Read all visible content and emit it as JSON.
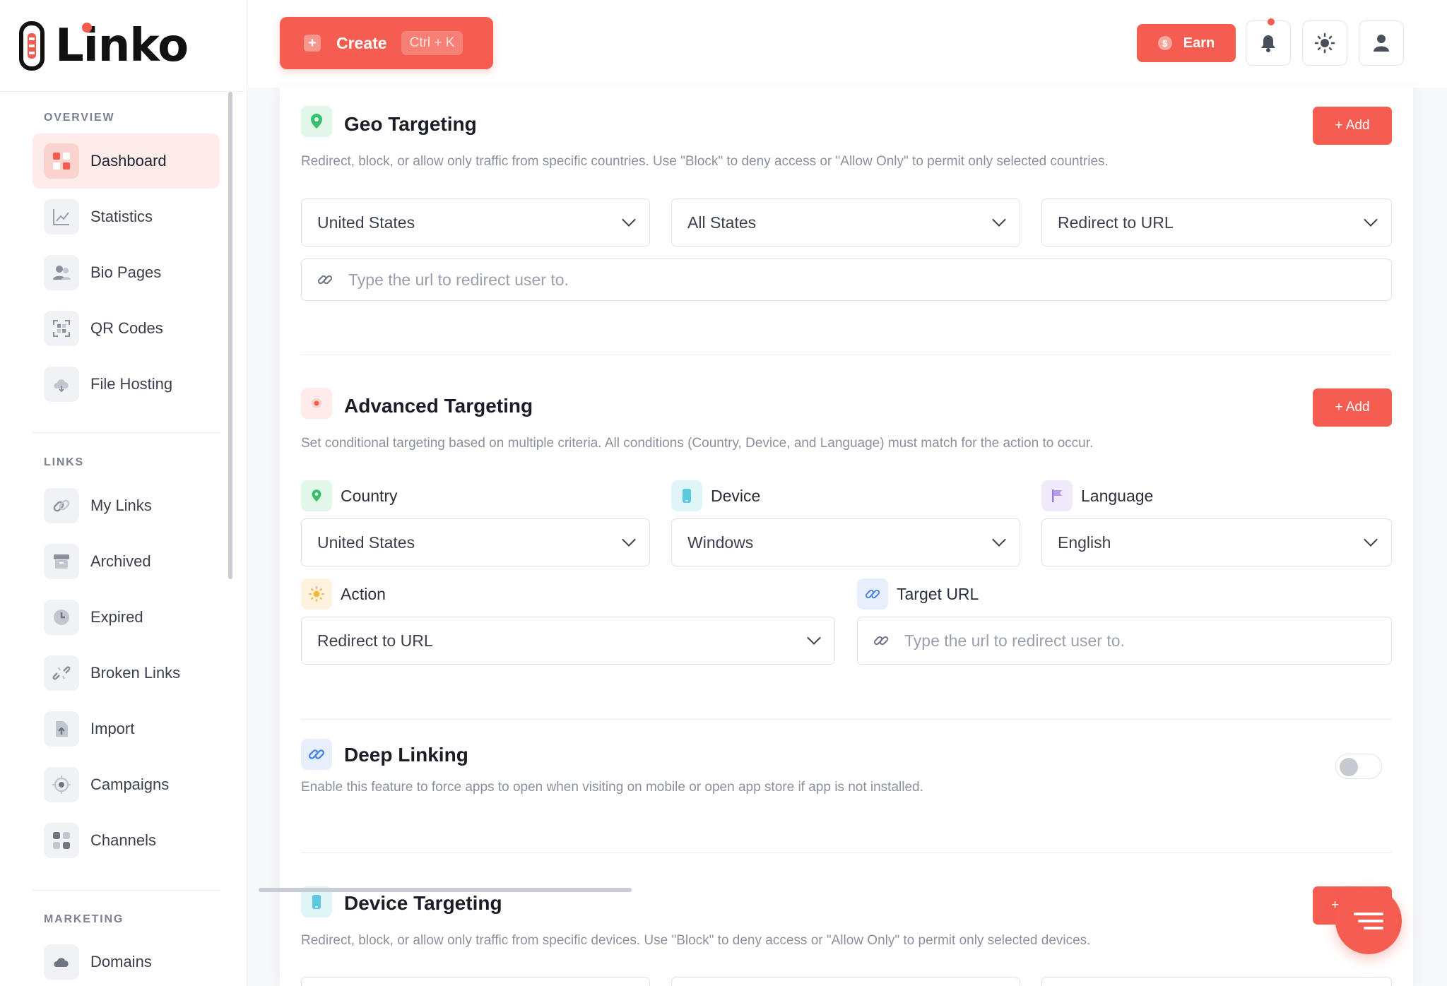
{
  "app": {
    "name": "Linko"
  },
  "sidebar": {
    "sections": [
      {
        "label": "OVERVIEW"
      },
      {
        "label": "LINKS"
      },
      {
        "label": "MARKETING"
      }
    ],
    "items": [
      {
        "label": "Dashboard",
        "icon": "dashboard-icon",
        "active": true
      },
      {
        "label": "Statistics",
        "icon": "chart-icon"
      },
      {
        "label": "Bio Pages",
        "icon": "users-icon"
      },
      {
        "label": "QR Codes",
        "icon": "qr-icon"
      },
      {
        "label": "File Hosting",
        "icon": "cloud-icon"
      },
      {
        "label": "My Links",
        "icon": "link-icon"
      },
      {
        "label": "Archived",
        "icon": "archive-icon"
      },
      {
        "label": "Expired",
        "icon": "clock-icon"
      },
      {
        "label": "Broken Links",
        "icon": "broken-link-icon"
      },
      {
        "label": "Import",
        "icon": "import-icon"
      },
      {
        "label": "Campaigns",
        "icon": "target-icon"
      },
      {
        "label": "Channels",
        "icon": "grid-icon"
      },
      {
        "label": "Domains",
        "icon": "cloud-icon"
      }
    ]
  },
  "header": {
    "create_label": "Create",
    "create_shortcut": "Ctrl + K",
    "earn_label": "Earn",
    "earn_coin": "$"
  },
  "geo": {
    "title": "Geo Targeting",
    "add_label": "+ Add",
    "description": "Redirect, block, or allow only traffic from specific countries. Use \"Block\" to deny access or \"Allow Only\" to permit only selected countries.",
    "country": "United States",
    "state": "All States",
    "action": "Redirect to URL",
    "url_placeholder": "Type the url to redirect user to."
  },
  "advanced": {
    "title": "Advanced Targeting",
    "add_label": "+ Add",
    "description": "Set conditional targeting based on multiple criteria. All conditions (Country, Device, and Language) must match for the action to occur.",
    "country_label": "Country",
    "country": "United States",
    "device_label": "Device",
    "device": "Windows",
    "language_label": "Language",
    "language": "English",
    "action_label": "Action",
    "action": "Redirect to URL",
    "target_label": "Target URL",
    "url_placeholder": "Type the url to redirect user to."
  },
  "deep_linking": {
    "title": "Deep Linking",
    "description": "Enable this feature to force apps to open when visiting on mobile or open app store if app is not installed.",
    "enabled": false
  },
  "device": {
    "title": "Device Targeting",
    "add_label": "+",
    "description": "Redirect, block, or allow only traffic from specific devices. Use \"Block\" to deny access or \"Allow Only\" to permit only selected devices."
  },
  "colors": {
    "accent": "#f55d50",
    "accent_light": "#fdecea",
    "green_bg": "#e3f6ea",
    "cyan_bg": "#e0f5f8",
    "purple_bg": "#efe9fb",
    "yellow_bg": "#fff3df",
    "blue_bg": "#e7effc"
  }
}
